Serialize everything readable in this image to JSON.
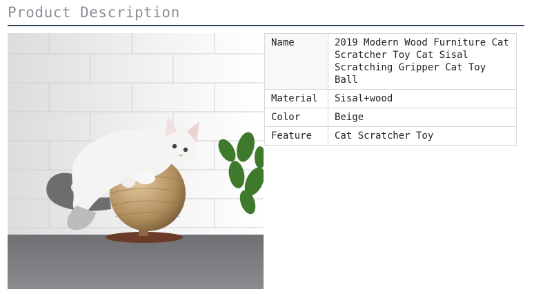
{
  "section": {
    "title": "Product Description"
  },
  "photo": {
    "alt": "white cat hugging a sisal scratcher ball"
  },
  "specs": [
    {
      "label": "Name",
      "value": "2019 Modern Wood Furniture Cat Scratcher Toy Cat Sisal Scratching Gripper Cat Toy Ball"
    },
    {
      "label": "Material",
      "value": "Sisal+wood"
    },
    {
      "label": "Color",
      "value": "Beige"
    },
    {
      "label": "Feature",
      "value": "Cat Scratcher Toy"
    }
  ]
}
